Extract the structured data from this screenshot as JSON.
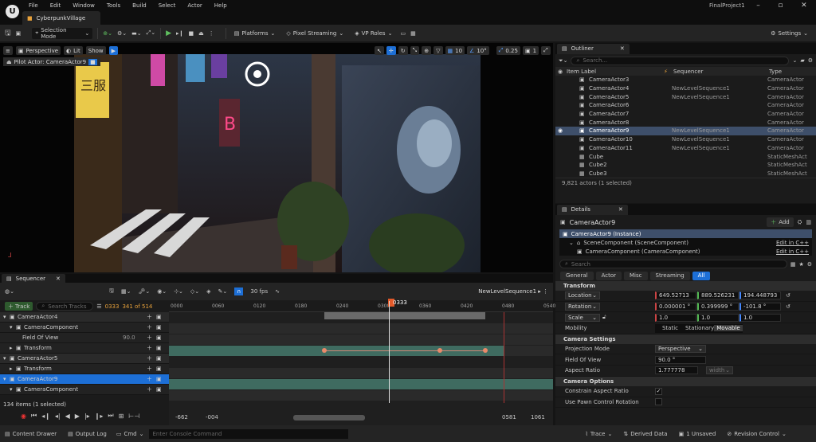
{
  "app": {
    "level_tab": "CyberpunkVillage",
    "project": "FinalProject1",
    "menu": [
      "File",
      "Edit",
      "Window",
      "Tools",
      "Build",
      "Select",
      "Actor",
      "Help"
    ]
  },
  "toolbar": {
    "mode": "Selection Mode",
    "platforms": "Platforms",
    "pixel_streaming": "Pixel Streaming",
    "vp_roles": "VP Roles",
    "settings": "Settings"
  },
  "viewport": {
    "perspective": "Perspective",
    "lit": "Lit",
    "show": "Show",
    "pilot": "Pilot Actor: CameraActor9",
    "grid_snap": "10",
    "rot_snap": "10°",
    "scale_snap": "0.25",
    "cam_speed": "1"
  },
  "outliner": {
    "tab": "Outliner",
    "search_placeholder": "Search...",
    "col_label": "Item Label",
    "col_seq": "Sequencer",
    "col_type": "Type",
    "footer": "9,821 actors (1 selected)",
    "rows": [
      {
        "label": "CameraActor3",
        "seq": "",
        "type": "CameraActor"
      },
      {
        "label": "CameraActor4",
        "seq": "NewLevelSequence1",
        "type": "CameraActor"
      },
      {
        "label": "CameraActor5",
        "seq": "NewLevelSequence1",
        "type": "CameraActor"
      },
      {
        "label": "CameraActor6",
        "seq": "",
        "type": "CameraActor"
      },
      {
        "label": "CameraActor7",
        "seq": "",
        "type": "CameraActor"
      },
      {
        "label": "CameraActor8",
        "seq": "",
        "type": "CameraActor"
      },
      {
        "label": "CameraActor9",
        "seq": "NewLevelSequence1",
        "type": "CameraActor"
      },
      {
        "label": "CameraActor10",
        "seq": "NewLevelSequence1",
        "type": "CameraActor"
      },
      {
        "label": "CameraActor11",
        "seq": "NewLevelSequence1",
        "type": "CameraActor"
      },
      {
        "label": "Cube",
        "seq": "",
        "type": "StaticMeshAct"
      },
      {
        "label": "Cube2",
        "seq": "",
        "type": "StaticMeshAct"
      },
      {
        "label": "Cube3",
        "seq": "",
        "type": "StaticMeshAct"
      }
    ]
  },
  "details": {
    "tab": "Details",
    "actor": "CameraActor9",
    "add": "Add",
    "instance": "CameraActor9 (Instance)",
    "scene_comp": "SceneComponent (SceneComponent)",
    "cam_comp": "CameraComponent (CameraComponent)",
    "edit_cpp": "Edit in C++",
    "search_placeholder": "Search",
    "filters": [
      "General",
      "Actor",
      "Misc",
      "Streaming",
      "All"
    ],
    "transform_hdr": "Transform",
    "location": "Location",
    "rotation": "Rotation",
    "scale": "Scale",
    "loc": [
      "649.52713",
      "889.526231",
      "194.448793"
    ],
    "rot": [
      "0.000001 °",
      "0.399999 °",
      "-101.8 °"
    ],
    "scl": [
      "1.0",
      "1.0",
      "1.0"
    ],
    "mobility": "Mobility",
    "mob_opts": [
      "Static",
      "Stationary",
      "Movable"
    ],
    "cam_settings_hdr": "Camera Settings",
    "proj_mode": "Projection Mode",
    "proj_val": "Perspective",
    "fov": "Field Of View",
    "fov_val": "90.0 °",
    "aspect": "Aspect Ratio",
    "aspect_val": "1.777778",
    "aspect_w": "width",
    "cam_options_hdr": "Camera Options",
    "constrain": "Constrain Aspect Ratio",
    "pawn": "Use Pawn Control Rotation"
  },
  "sequencer": {
    "tab": "Sequencer",
    "fps": "30 fps",
    "seq_name": "NewLevelSequence1",
    "track": "Track",
    "search_placeholder": "Search Tracks",
    "frame": "0333",
    "frame_of": "341 of 514",
    "playhead": "0333",
    "items": "134 items (1 selected)",
    "ticks": [
      "0000",
      "0060",
      "0120",
      "0180",
      "0240",
      "0300",
      "0360",
      "0420",
      "0480",
      "0540"
    ],
    "tracks": [
      {
        "label": "CameraActor4",
        "level": 0,
        "value": ""
      },
      {
        "label": "CameraComponent",
        "level": 1,
        "value": ""
      },
      {
        "label": "Field Of View",
        "level": 2,
        "value": "90.0"
      },
      {
        "label": "Transform",
        "level": 1,
        "value": ""
      },
      {
        "label": "CameraActor5",
        "level": 0,
        "value": ""
      },
      {
        "label": "Transform",
        "level": 1,
        "value": ""
      },
      {
        "label": "CameraActor9",
        "level": 0,
        "value": ""
      },
      {
        "label": "CameraComponent",
        "level": 1,
        "value": ""
      }
    ],
    "range_start": "-662",
    "range_in": "-004",
    "range_out": "0581",
    "range_end": "1061"
  },
  "status": {
    "content_drawer": "Content Drawer",
    "output_log": "Output Log",
    "cmd": "Cmd",
    "console_placeholder": "Enter Console Command",
    "trace": "Trace",
    "derived": "Derived Data",
    "unsaved": "1 Unsaved",
    "revision": "Revision Control"
  }
}
